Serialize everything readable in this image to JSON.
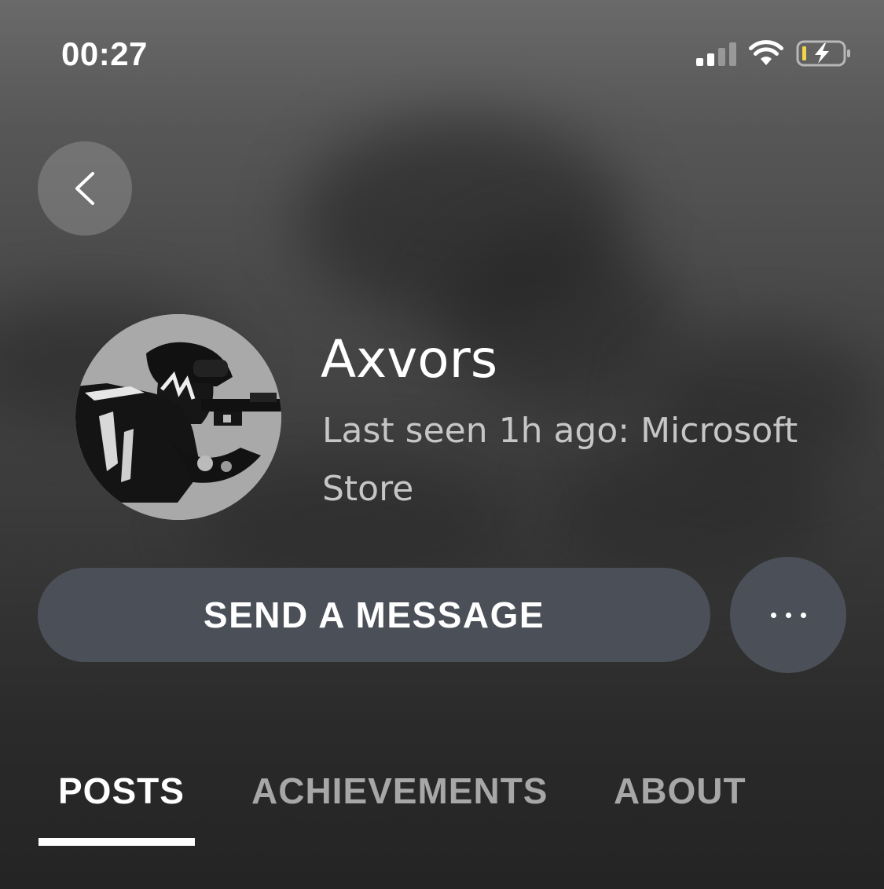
{
  "status_bar": {
    "time": "00:27",
    "signal_icon": "cellular-signal-icon",
    "wifi_icon": "wifi-icon",
    "battery_icon": "battery-charging-icon"
  },
  "navigation": {
    "back_icon": "chevron-left-icon"
  },
  "profile": {
    "gamertag": "Axvors",
    "last_seen": "Last seen 1h ago: Microsoft Store",
    "avatar_icon": "soldier-avatar"
  },
  "actions": {
    "send_message_label": "SEND A MESSAGE",
    "more_icon": "more-options-icon"
  },
  "tabs": [
    {
      "label": "POSTS",
      "selected": true
    },
    {
      "label": "ACHIEVEMENTS",
      "selected": false
    },
    {
      "label": "ABOUT",
      "selected": false
    }
  ],
  "colors": {
    "button_bg": "#4b5058",
    "tab_inactive": "#a7a7a7",
    "battery_low": "#f3d34a"
  }
}
